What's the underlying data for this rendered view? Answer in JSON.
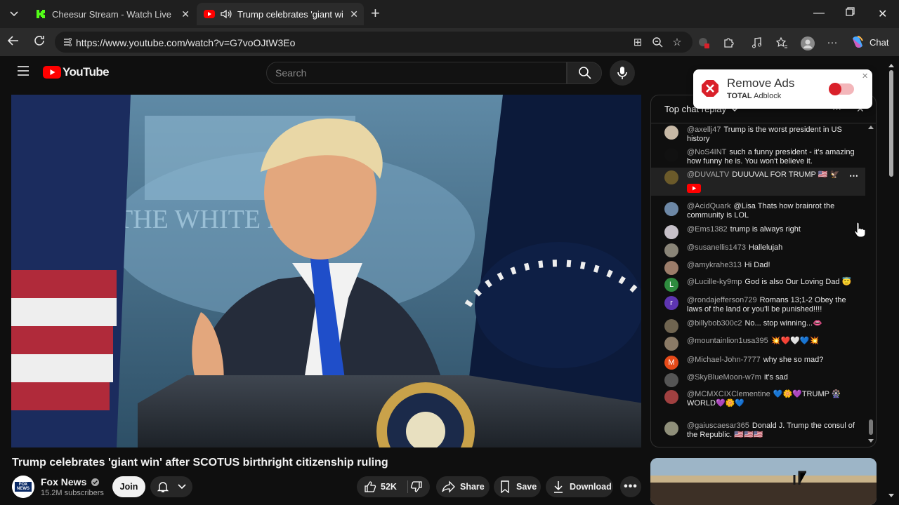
{
  "browser": {
    "tabs": [
      {
        "title": "Cheesur Stream - Watch Live on K",
        "active": false
      },
      {
        "title": "Trump celebrates 'giant win' a",
        "active": true
      }
    ],
    "url": "https://www.youtube.com/watch?v=G7voOJtW3Eo",
    "chat_button_label": "Chat"
  },
  "youtube": {
    "logo_text": "YouTube",
    "search_placeholder": "Search"
  },
  "video": {
    "title": "Trump celebrates 'giant win' after SCOTUS birthright citizenship ruling",
    "channel_name": "Fox News",
    "channel_logo_text": "FOX NEWS",
    "subscribers": "15.2M subscribers",
    "join_label": "Join",
    "likes": "52K",
    "share_label": "Share",
    "save_label": "Save",
    "download_label": "Download"
  },
  "chat": {
    "header": "Top chat replay",
    "messages": [
      {
        "author": "@axellj47",
        "text": "Trump is the worst president in US history",
        "avatar_color": "#c7b9a6"
      },
      {
        "author": "@NoS4INT",
        "text": "such a funny president - it's amazing how funny he is. You won't believe it.",
        "avatar_color": "#111111"
      },
      {
        "author": "@DUVALTV",
        "text": "DUUUVAL FOR TRUMP 🇺🇸 🦅",
        "avatar_color": "#6b5a2a",
        "highlight": true
      },
      {
        "author": "@AcidQuark",
        "text": "@Lisa Thats how brainrot the community is LOL",
        "avatar_color": "#6d88a6"
      },
      {
        "author": "@Ems1382",
        "text": "trump is always right",
        "avatar_color": "#c6c0c8"
      },
      {
        "author": "@susanellis1473",
        "text": "Hallelujah",
        "avatar_color": "#8a8578"
      },
      {
        "author": "@amykrahe313",
        "text": "Hi Dad!",
        "avatar_color": "#9c7d6a"
      },
      {
        "author": "@Lucille-ky9mp",
        "text": "God is also Our Loving Dad 😇",
        "avatar_color": "#2e8b3e",
        "initial": "L"
      },
      {
        "author": "@rondajefferson729",
        "text": "Romans 13;1-2 Obey the laws of the land or you'll be punished!!!!",
        "avatar_color": "#5e35b1",
        "initial": "r"
      },
      {
        "author": "@billybob300c2",
        "text": "No... stop winning...👄",
        "avatar_color": "#6f6450"
      },
      {
        "author": "@mountainlion1usa395",
        "text": "💥❤️🤍💙💥",
        "avatar_color": "#8a7a66"
      },
      {
        "author": "@Michael-John-7777",
        "text": "why she so mad?",
        "avatar_color": "#e64a19",
        "initial": "M"
      },
      {
        "author": "@SkyBlueMoon-w7m",
        "text": "it's sad",
        "avatar_color": "#555555"
      },
      {
        "author": "@MCMXCIXClementine",
        "text": "💙🌼💜TRUMP 🎡WORLD💜🌼💙",
        "avatar_color": "#a04040"
      },
      {
        "author": "@gaiuscaesar365",
        "text": "Donald J. Trump the consul of the Republic. 🇺🇸🇺🇸🇺🇸",
        "avatar_color": "#8f8f7a"
      }
    ]
  },
  "adblock": {
    "title": "Remove Ads",
    "brand_bold": "TOTAL",
    "brand_rest": " Adblock"
  },
  "colors": {
    "youtube_red": "#ff0000",
    "adblock_red": "#d9202a",
    "background": "#0f0f0f"
  }
}
